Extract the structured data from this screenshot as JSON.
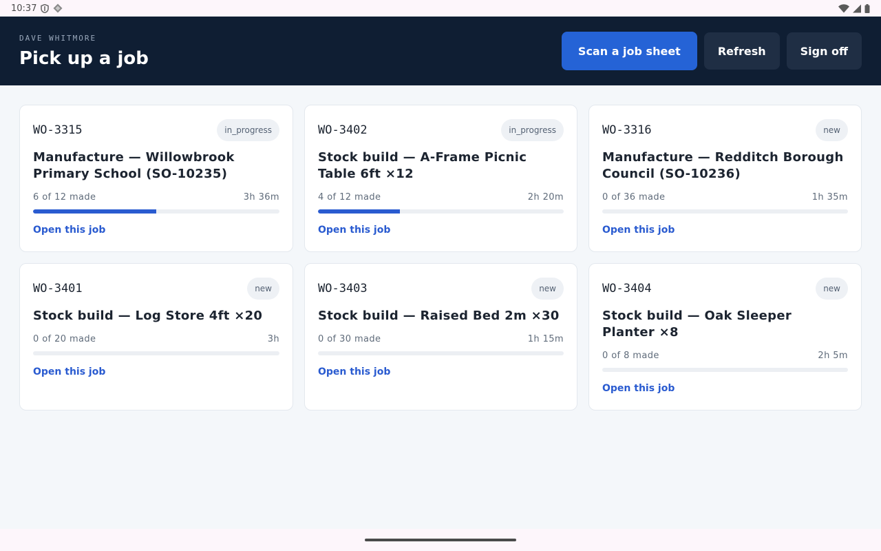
{
  "status_bar": {
    "time": "10:37",
    "left_icons": [
      "shield-icon",
      "diamond-icon"
    ],
    "right_icons": [
      "wifi-icon",
      "cell-signal-icon",
      "battery-icon"
    ]
  },
  "header": {
    "operator_name": "DAVE WHITMORE",
    "title": "Pick up a job",
    "actions": {
      "scan": "Scan a job sheet",
      "refresh": "Refresh",
      "sign_off": "Sign off"
    },
    "colors": {
      "background": "#0f1e33",
      "primary": "#2563d6",
      "secondary": "#1f2e44"
    }
  },
  "jobs": [
    {
      "id": "WO-3315",
      "status": "in_progress",
      "title": "Manufacture — Willowbrook Primary School (SO-10235)",
      "made": "6 of 12 made",
      "progress": 0.5,
      "time": "3h 36m",
      "link": "Open this job"
    },
    {
      "id": "WO-3402",
      "status": "in_progress",
      "title": "Stock build — A-Frame Picnic Table 6ft ×12",
      "made": "4 of 12 made",
      "progress": 0.333,
      "time": "2h 20m",
      "link": "Open this job"
    },
    {
      "id": "WO-3316",
      "status": "new",
      "title": "Manufacture — Redditch Borough Council (SO-10236)",
      "made": "0 of 36 made",
      "progress": 0,
      "time": "1h 35m",
      "link": "Open this job"
    },
    {
      "id": "WO-3401",
      "status": "new",
      "title": "Stock build — Log Store 4ft ×20",
      "made": "0 of 20 made",
      "progress": 0,
      "time": "3h",
      "link": "Open this job"
    },
    {
      "id": "WO-3403",
      "status": "new",
      "title": "Stock build — Raised Bed 2m ×30",
      "made": "0 of 30 made",
      "progress": 0,
      "time": "1h 15m",
      "link": "Open this job"
    },
    {
      "id": "WO-3404",
      "status": "new",
      "title": "Stock build — Oak Sleeper Planter ×8",
      "made": "0 of 8 made",
      "progress": 0,
      "time": "2h 5m",
      "link": "Open this job"
    }
  ],
  "accent_color": "#2a5bd0"
}
